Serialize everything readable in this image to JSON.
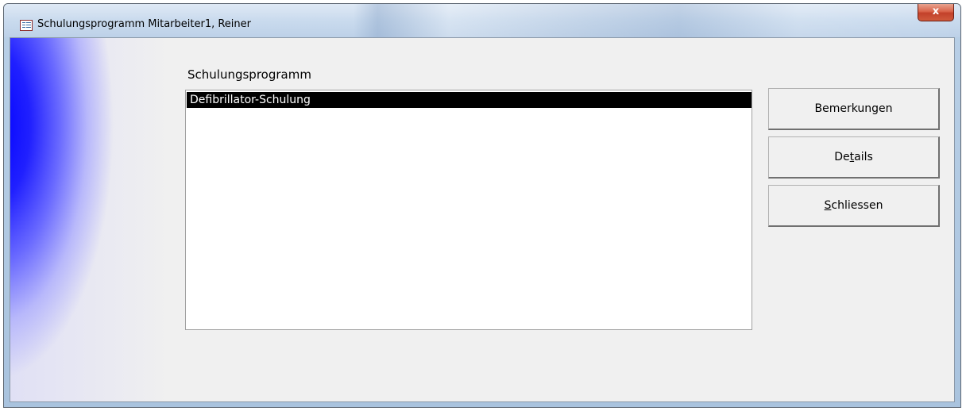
{
  "window": {
    "title": "Schulungsprogramm Mitarbeiter1, Reiner",
    "close_glyph": "x",
    "icon": "form-icon"
  },
  "form": {
    "list_label": "Schulungsprogramm",
    "list_items": [
      "Defibrillator-Schulung"
    ],
    "selected_index": 0
  },
  "buttons": {
    "remarks": "Bemerkungen",
    "details_before": "De",
    "details_accel": "t",
    "details_after": "ails",
    "close_accel": "S",
    "close_after": "chliessen"
  },
  "colors": {
    "selection_bg": "#000000",
    "selection_text": "#ffffff",
    "close_button": "#c2412a",
    "accent_gradient": "#0000ff"
  }
}
